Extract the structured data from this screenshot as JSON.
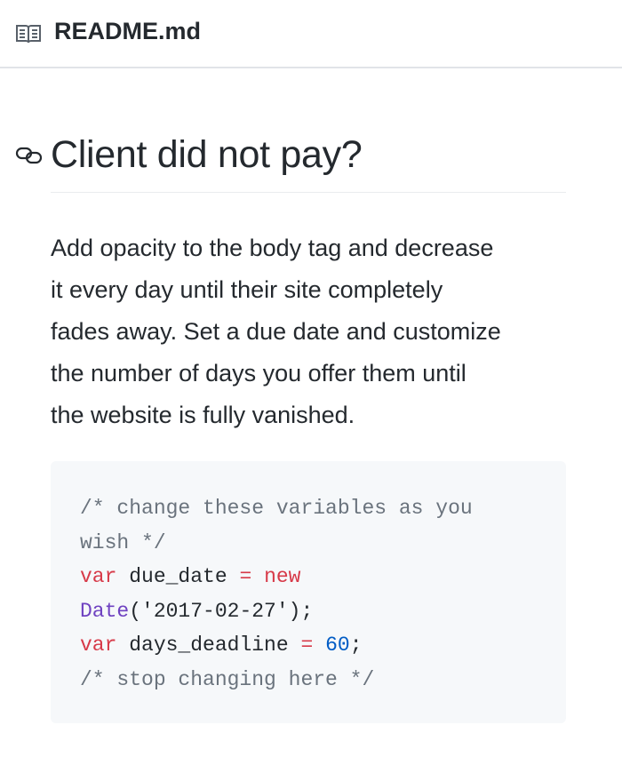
{
  "header": {
    "icon": "book-icon",
    "filename": "README.md"
  },
  "heading": {
    "anchor_icon": "link-icon",
    "title": "Client did not pay?"
  },
  "paragraph_lines": [
    "Add opacity to the body tag and decrease",
    "it every day until their site completely",
    "fades away. Set a due date and customize",
    "the number of days you offer them until",
    "the website is fully vanished."
  ],
  "code_lines": [
    [
      {
        "t": "comment",
        "v": "/* change these variables as you"
      }
    ],
    [
      {
        "t": "comment",
        "v": "wish */"
      }
    ],
    [
      {
        "t": "keyword",
        "v": "var"
      },
      {
        "t": "plain",
        "v": " due_date "
      },
      {
        "t": "keyword",
        "v": "="
      },
      {
        "t": "plain",
        "v": " "
      },
      {
        "t": "keyword",
        "v": "new"
      }
    ],
    [
      {
        "t": "fn",
        "v": "Date"
      },
      {
        "t": "plain",
        "v": "('2017-02-27');"
      }
    ],
    [
      {
        "t": "keyword",
        "v": "var"
      },
      {
        "t": "plain",
        "v": " days_deadline "
      },
      {
        "t": "keyword",
        "v": "="
      },
      {
        "t": "plain",
        "v": " "
      },
      {
        "t": "num",
        "v": "60"
      },
      {
        "t": "plain",
        "v": ";"
      }
    ],
    [
      {
        "t": "comment",
        "v": "/* stop changing here */"
      }
    ]
  ],
  "colors": {
    "comment": "#6a737d",
    "keyword": "#d73a49",
    "function": "#6f42c1",
    "number": "#005cc5",
    "code_bg": "#f6f8fa"
  }
}
